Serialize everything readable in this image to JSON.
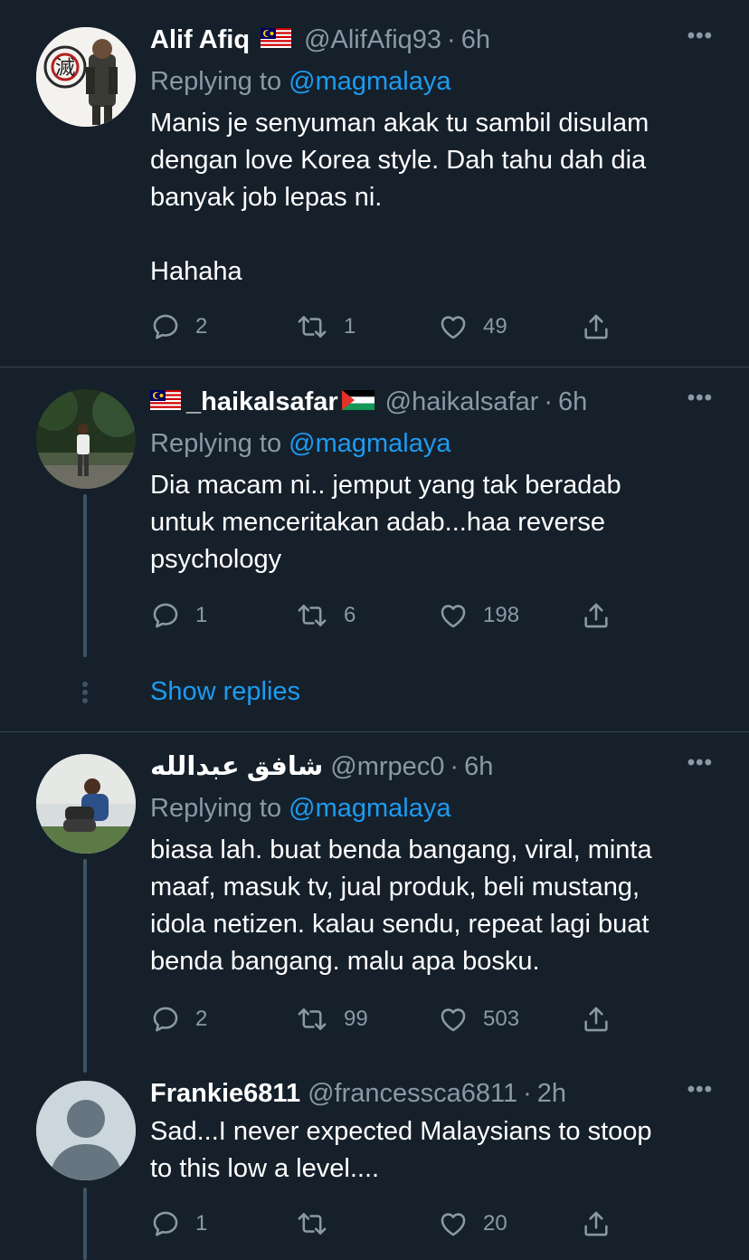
{
  "tweets": [
    {
      "name": "Alif Afiq",
      "handle": "@AlifAfiq93",
      "time": "6h",
      "reply_label": "Replying to",
      "reply_mention": "@magmalaya",
      "text": "Manis je senyuman akak tu sambil disulam\ndengan love Korea style. Dah tahu dah dia\nbanyak job lepas ni.\n\nHahaha",
      "replies": "2",
      "retweets": "1",
      "likes": "49"
    },
    {
      "name": "_haikalsafar",
      "handle": "@haikalsafar",
      "time": "6h",
      "reply_label": "Replying to",
      "reply_mention": "@magmalaya",
      "text": "Dia macam ni.. jemput yang tak beradab\nuntuk menceritakan adab...haa reverse\npsychology",
      "replies": "1",
      "retweets": "6",
      "likes": "198",
      "show_replies": "Show replies"
    },
    {
      "name": "شافق عبدالله",
      "handle": "@mrpec0",
      "time": "6h",
      "reply_label": "Replying to",
      "reply_mention": "@magmalaya",
      "text": "biasa lah. buat benda bangang, viral, minta\nmaaf, masuk tv, jual produk, beli mustang,\nidola netizen. kalau sendu, repeat lagi buat\nbenda bangang. malu apa bosku.",
      "replies": "2",
      "retweets": "99",
      "likes": "503"
    },
    {
      "name": "Frankie6811",
      "handle": "@francessca6811",
      "time": "2h",
      "text": "Sad...I never expected Malaysians to stoop\nto this low a level....",
      "replies": "1",
      "retweets": "",
      "likes": "20"
    }
  ],
  "separator": "·",
  "more_glyph": "•••",
  "colors": {
    "background": "#15202b",
    "secondary_text": "#8b98a5",
    "link": "#1d9bf0",
    "divider": "#38444d",
    "thread_line": "#3d5466"
  },
  "icons": [
    "reply-icon",
    "retweet-icon",
    "like-icon",
    "share-icon",
    "more-icon",
    "flag-malaysia-icon",
    "flag-palestine-icon"
  ]
}
